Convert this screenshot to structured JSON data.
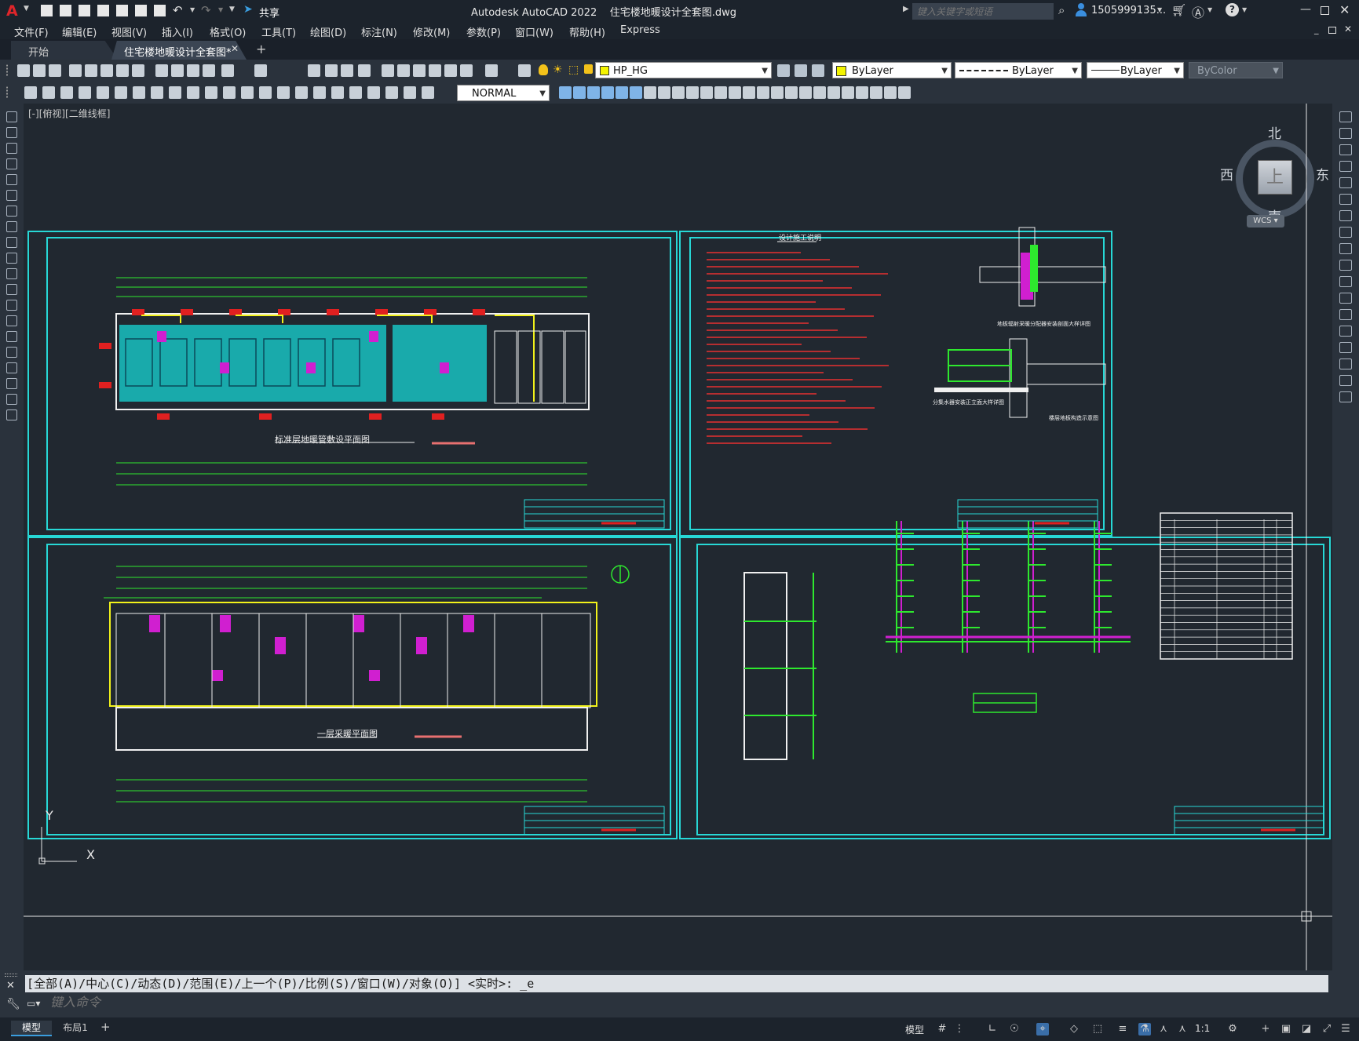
{
  "titlebar": {
    "app_title": "Autodesk AutoCAD 2022",
    "doc_title": "住宅楼地暖设计全套图.dwg",
    "share_label": "共享",
    "search_placeholder": "键入关键字或短语",
    "user": "1505999135...",
    "logo": "A"
  },
  "menu": {
    "items": [
      "文件(F)",
      "编辑(E)",
      "视图(V)",
      "插入(I)",
      "格式(O)",
      "工具(T)",
      "绘图(D)",
      "标注(N)",
      "修改(M)",
      "参数(P)",
      "窗口(W)",
      "帮助(H)",
      "Express"
    ]
  },
  "tabs": {
    "start": "开始",
    "active": "住宅楼地暖设计全套图*",
    "add": "+"
  },
  "toolbar": {
    "layer": "HP_HG",
    "color": "ByLayer",
    "linetype": "ByLayer",
    "lineweight": "ByLayer",
    "plotstyle": "ByColor",
    "dimstyle": "NORMAL"
  },
  "canvas": {
    "viewport_label": "[-][俯视][二维线框]",
    "viewcube": {
      "north": "北",
      "south": "南",
      "east": "东",
      "west": "西",
      "top": "上",
      "wcs": "WCS"
    },
    "ucs": {
      "x": "X",
      "y": "Y"
    },
    "sheets": {
      "s1_title": "标准层地暖管敷设平面图",
      "s2_title": "设计施工说明",
      "s2_detail1": "地板辐射采暖分配器安装剖面大样详图",
      "s2_detail2": "分集水器安装正立面大样详图",
      "s2_detail3": "楼层地板构造示意图",
      "s3_title": "一层采暖平面图"
    }
  },
  "command": {
    "history": "[全部(A)/中心(C)/动态(D)/范围(E)/上一个(P)/比例(S)/窗口(W)/对象(O)] <实时>: _e",
    "placeholder": "键入命令"
  },
  "statusbar": {
    "tab_model": "模型",
    "tab_layout": "布局1",
    "add": "+",
    "model_label": "模型",
    "scale": "1:1"
  }
}
